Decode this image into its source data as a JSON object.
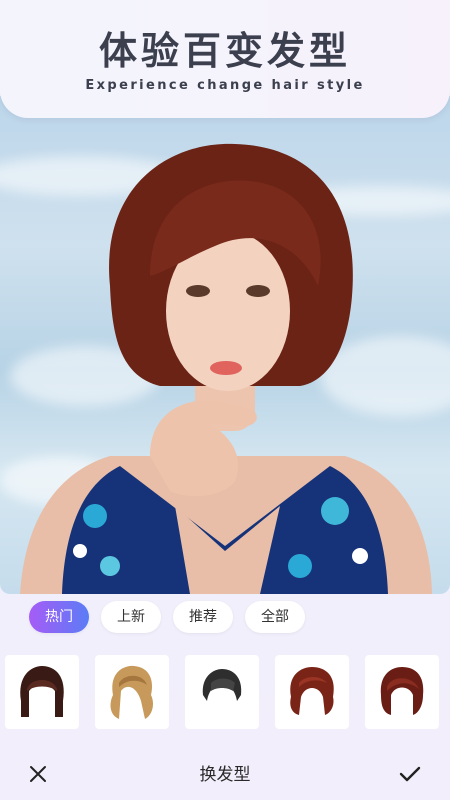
{
  "header": {
    "title": "体验百变发型",
    "subtitle": "Experience change hair style"
  },
  "tabs": [
    {
      "label": "热门",
      "active": true
    },
    {
      "label": "上新",
      "active": false
    },
    {
      "label": "推荐",
      "active": false
    },
    {
      "label": "全部",
      "active": false
    }
  ],
  "hairstyles": [
    {
      "icon": "hair-bob-dark-icon"
    },
    {
      "icon": "hair-blonde-curly-icon"
    },
    {
      "icon": "hair-short-black-icon"
    },
    {
      "icon": "hair-curly-red-icon"
    },
    {
      "icon": "hair-bob-red-icon"
    }
  ],
  "bottom_bar": {
    "title": "换发型",
    "close_icon": "close-icon",
    "confirm_icon": "check-icon"
  },
  "colors": {
    "accent_gradient_start": "#a65cf6",
    "accent_gradient_end": "#5b7cf6",
    "text_dark": "#3b3f4e"
  }
}
